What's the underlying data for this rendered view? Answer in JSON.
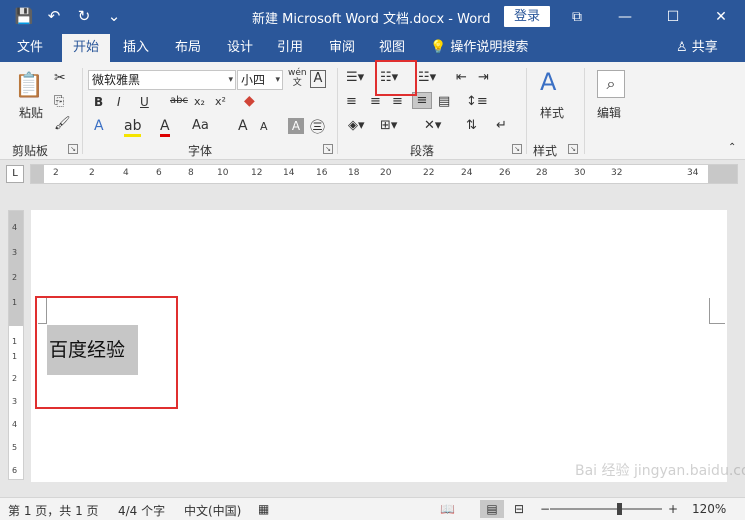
{
  "titlebar": {
    "doc_title": "新建 Microsoft Word 文档.docx  -  Word",
    "login_label": "登录",
    "qat": [
      "💾",
      "↶",
      "↻",
      "⌄"
    ],
    "win_controls": [
      "⧉",
      "—",
      "☐",
      "✕"
    ]
  },
  "tabs": {
    "items": [
      "文件",
      "开始",
      "插入",
      "布局",
      "设计",
      "引用",
      "审阅",
      "视图"
    ],
    "active": "开始",
    "tell_me": "💡 操作说明搜索",
    "share": "♙ 共享"
  },
  "ribbon": {
    "clipboard": {
      "paste": "粘贴",
      "label": "剪贴板"
    },
    "font": {
      "family": "微软雅黑",
      "size": "小四",
      "buttons": [
        "B",
        "I",
        "U",
        "abc",
        "x₂",
        "x²"
      ],
      "row3": [
        "A",
        "A",
        "A",
        "Aa",
        "A",
        "A",
        "A",
        "㊂"
      ],
      "label": "字体",
      "wen": "wén",
      "wen_char": "文",
      "boxed_a": "A"
    },
    "paragraph": {
      "label": "段落"
    },
    "styles": {
      "label": "样式",
      "button": "样式"
    },
    "editing": {
      "button": "编辑"
    }
  },
  "ruler": {
    "marks": [
      "2",
      "2",
      "4",
      "6",
      "8",
      "10",
      "12",
      "14",
      "16",
      "18",
      "20",
      "22",
      "24",
      "26",
      "28",
      "30",
      "32",
      "34"
    ],
    "corner": "L",
    "vmarks": [
      "4",
      "3",
      "2",
      "1",
      "1",
      "1",
      "2",
      "3",
      "4",
      "5",
      "6"
    ]
  },
  "document": {
    "text": "百度经验"
  },
  "statusbar": {
    "page": "第 1 页，共 1 页",
    "words": "4/4 个字",
    "language": "中文(中国)",
    "zoom": "120%",
    "zoom_minus": "−",
    "zoom_plus": "+"
  },
  "watermark": "Bai 经验 jingyan.baidu.com",
  "colors": {
    "accent": "#2b579a",
    "highlight": "#e02f2f"
  }
}
